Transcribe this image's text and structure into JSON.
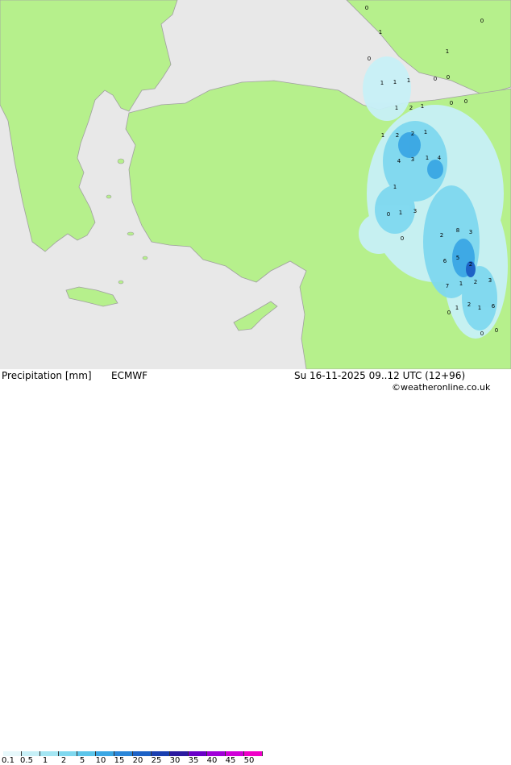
{
  "title": "Precipitation [mm]",
  "model": "ECMWF",
  "datetime": "Su 16-11-2025 09..12 UTC (12+96)",
  "credit": "©weatheronline.co.uk",
  "colors": {
    "sea": "#e8e8e8",
    "land": "#b6f08c",
    "coast": "#a0a0a0"
  },
  "legend": {
    "ticks": [
      "0.1",
      "0.5",
      "1",
      "2",
      "5",
      "10",
      "15",
      "20",
      "25",
      "30",
      "35",
      "40",
      "45",
      "50"
    ],
    "colors": [
      "#e6f8fb",
      "#c7f0f7",
      "#a4e6f3",
      "#7fd8ef",
      "#5bc5ea",
      "#3aa7e4",
      "#2a86d8",
      "#1d62c6",
      "#1a3fb0",
      "#2b1aa0",
      "#6a00c8",
      "#a000d8",
      "#d000d8",
      "#f000c8"
    ]
  },
  "map_points": [
    "0",
    "0",
    "1",
    "1",
    "0",
    "1",
    "1",
    "1",
    "0",
    "0",
    "0",
    "0",
    "1",
    "2",
    "1",
    "1",
    "2",
    "2",
    "1",
    "4",
    "3",
    "1",
    "4",
    "1",
    "0",
    "1",
    "3",
    "2",
    "8",
    "3",
    "6",
    "5",
    "2",
    "7",
    "1",
    "2",
    "3",
    "1",
    "2",
    "1",
    "0",
    "6",
    "0",
    "0",
    "0"
  ]
}
